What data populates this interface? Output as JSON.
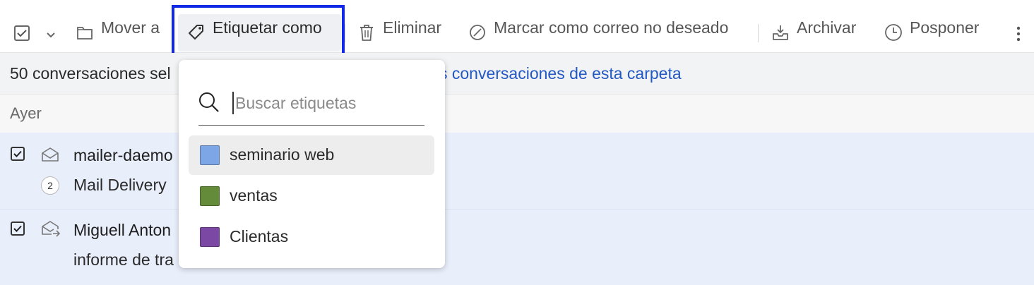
{
  "toolbar": {
    "move_label": "Mover a",
    "tag_label": "Etiquetar como",
    "delete_label": "Eliminar",
    "spam_label": "Marcar como correo no deseado",
    "archive_label": "Archivar",
    "snooze_label": "Posponer"
  },
  "selection": {
    "text": "50 conversaciones sel",
    "link_text": "s conversaciones de esta carpeta"
  },
  "group": {
    "label": "Ayer"
  },
  "conversations": [
    {
      "sender": "mailer-daemo",
      "subject": "Mail Delivery",
      "count": "2",
      "checked": true
    },
    {
      "sender": "Miguell Anton",
      "subject": "informe de tra",
      "checked": true
    }
  ],
  "tag_menu": {
    "search_placeholder": "Buscar etiquetas",
    "labels": [
      {
        "name": "seminario web",
        "color": "#7da6e6"
      },
      {
        "name": "ventas",
        "color": "#648b3a"
      },
      {
        "name": "Clientas",
        "color": "#7b48a3"
      }
    ]
  },
  "colors": {
    "accent_link": "#2358c4",
    "highlight_border": "#1029e6",
    "selected_row_bg": "#e9eefb"
  }
}
